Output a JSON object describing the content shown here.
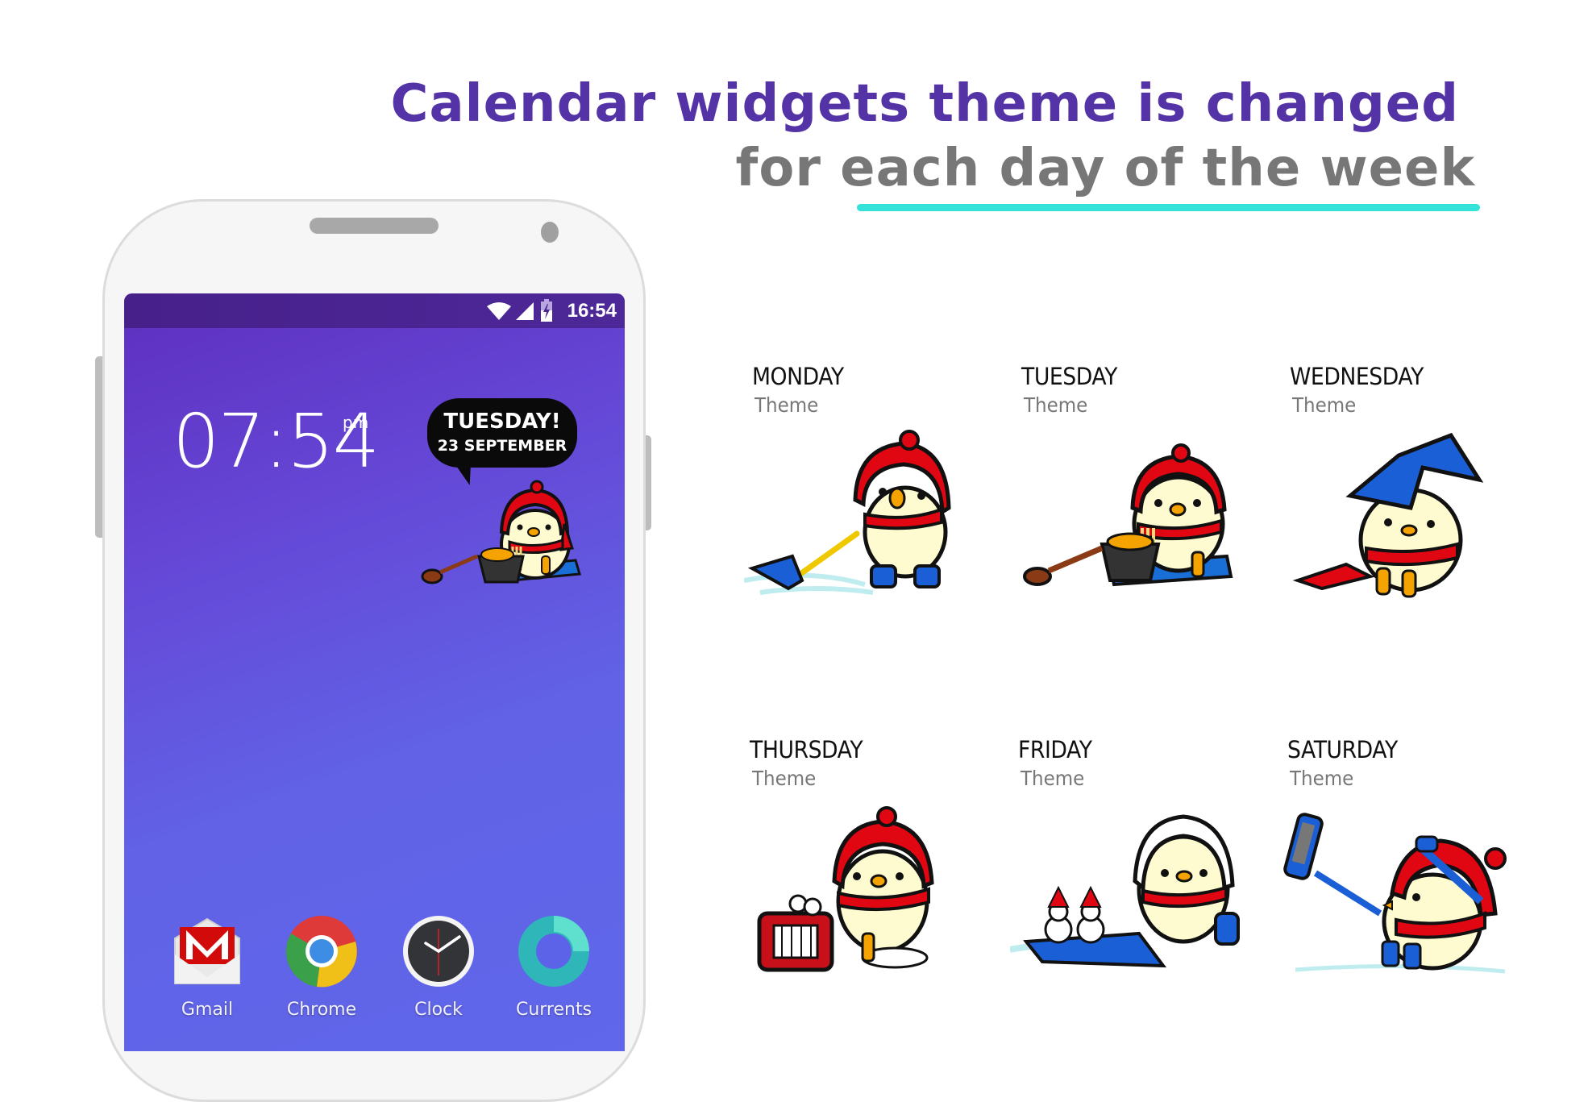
{
  "headline": {
    "line1": "Calendar widgets theme is changed",
    "line2": "for each day of the week",
    "line1_color": "#5433a6",
    "line2_color": "#777777",
    "underline_color": "#33e3da"
  },
  "phone": {
    "status_bar": {
      "time": "16:54",
      "icons": [
        "wifi-icon",
        "cellular-signal-icon",
        "battery-charging-icon"
      ]
    },
    "clock_widget": {
      "time": "07:54",
      "ampm": "pm"
    },
    "calendar_widget": {
      "day": "TUESDAY!",
      "date": "23 SEPTEMBER",
      "character": "duck-eating-noodles"
    },
    "dock": [
      {
        "label": "Gmail",
        "icon": "gmail-icon"
      },
      {
        "label": "Chrome",
        "icon": "chrome-icon"
      },
      {
        "label": "Clock",
        "icon": "clock-icon"
      },
      {
        "label": "Currents",
        "icon": "currents-icon"
      }
    ]
  },
  "themes": [
    {
      "day": "MONDAY",
      "label": "Theme",
      "art": "duck-shoveling-snow"
    },
    {
      "day": "TUESDAY",
      "label": "Theme",
      "art": "duck-eating-noodles"
    },
    {
      "day": "WEDNESDAY",
      "label": "Theme",
      "art": "duck-with-book-on-head"
    },
    {
      "day": "THURSDAY",
      "label": "Theme",
      "art": "duck-with-heater"
    },
    {
      "day": "FRIDAY",
      "label": "Theme",
      "art": "duck-sledding-with-snowmen"
    },
    {
      "day": "SATURDAY",
      "label": "Theme",
      "art": "duck-taking-selfie"
    }
  ],
  "colors": {
    "duck_body": "#fffbd0",
    "hat_red": "#e00612",
    "boot_blue": "#1a5fd6",
    "beak_orange": "#f5a300",
    "outline": "#111111",
    "snow": "#bfecef"
  }
}
